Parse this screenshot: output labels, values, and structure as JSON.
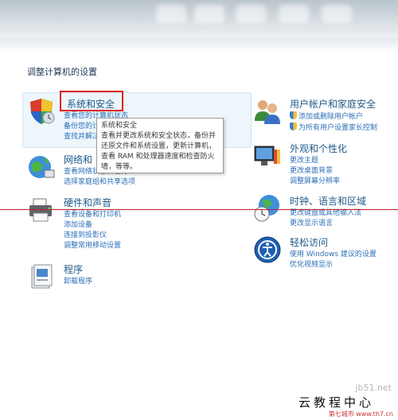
{
  "heading": "调整计算机的设置",
  "left_categories": [
    {
      "title": "系统和安全",
      "links": [
        "查看您的计算机状态",
        "备份您的计算机",
        "查找并解决问题"
      ]
    },
    {
      "title": "网络和 Internet",
      "links": [
        "查看网络状态和任务",
        "选择家庭组和共享选项"
      ]
    },
    {
      "title": "硬件和声音",
      "links": [
        "查看设备和打印机",
        "添加设备",
        "连接到投影仪",
        "调整常用移动设置"
      ]
    },
    {
      "title": "程序",
      "links": [
        "卸载程序"
      ]
    }
  ],
  "right_categories": [
    {
      "title": "用户帐户和家庭安全",
      "links": [
        "添加或删除用户帐户",
        "为所有用户设置家长控制"
      ]
    },
    {
      "title": "外观和个性化",
      "links": [
        "更改主题",
        "更改桌面背景",
        "调整屏幕分辨率"
      ]
    },
    {
      "title": "时钟、语言和区域",
      "links": [
        "更改键盘或其他输入法",
        "更改显示语言"
      ]
    },
    {
      "title": "轻松访问",
      "links": [
        "使用 Windows 建议的设置",
        "优化视频显示"
      ]
    }
  ],
  "tooltip": {
    "title": "系统和安全",
    "body": "查看并更改系统和安全状态，备份并还原文件和系统设置，更新计算机，查看 RAM 和处理器速度和检查防火墙，等等。"
  },
  "watermark": {
    "main": "云教程中心",
    "sub": "第七城市 www.th7.cn",
    "faint": "jb51.net"
  },
  "colors": {
    "link": "#2c6fb7",
    "title": "#1e5a8a",
    "highlight": "#e02020"
  }
}
